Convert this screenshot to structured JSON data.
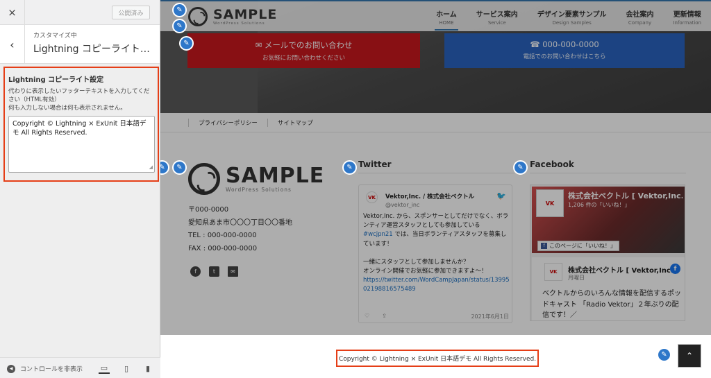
{
  "sidebar": {
    "close_icon": "×",
    "publish_label": "公開済み",
    "back_icon": "‹",
    "breadcrumb": "カスタマイズ中",
    "title": "Lightning コピーライト…",
    "section": {
      "title": "Lightning コピーライト設定",
      "description_1": "代わりに表示したいフッターテキストを入力してください（HTML有効）",
      "description_2": "何も入力しない場合は何も表示されません。",
      "textarea_value": "Copyright © Lightning × ExUnit 日本語デモ All Rights Reserved."
    },
    "hide_controls_label": "コントロールを非表示",
    "devices": [
      "desktop-icon",
      "tablet-icon",
      "mobile-icon"
    ]
  },
  "preview": {
    "logo": {
      "name": "SAMPLE",
      "tagline": "WordPress Solutions"
    },
    "nav": [
      {
        "jp": "ホーム",
        "en": "HOME"
      },
      {
        "jp": "サービス案内",
        "en": "Service"
      },
      {
        "jp": "デザイン要素サンプル",
        "en": "Design Samples"
      },
      {
        "jp": "会社案内",
        "en": "Company"
      },
      {
        "jp": "更新情報",
        "en": "Information"
      }
    ],
    "mail_button": {
      "line1": "✉  メールでのお問い合わせ",
      "line2": "お気軽にお問い合わせください"
    },
    "tel_button": {
      "line1": "☎  000-000-0000",
      "line2": "電話でのお問い合わせはこちら"
    },
    "subnav": [
      "プライバシーポリシー",
      "サイトマップ"
    ],
    "address": {
      "zip": "〒000-0000",
      "street": "愛知県あま市〇〇〇丁目〇〇番地",
      "tel": "TEL : 000-000-0000",
      "fax": "FAX : 000-000-0000"
    },
    "twitter": {
      "title": "Twitter",
      "avatar": "VK",
      "name": "Vektor,Inc. / 株式会社ベクトル",
      "handle": "@vektor_inc",
      "text_1": "Vektor,Inc. から、スポンサーとしてだけでなく、ボランティア運営スタッフとしても参加している",
      "hashtag": "#wcjpn21",
      "text_2": " では、当日ボランティアスタッフを募集しています！",
      "text_3": "一緒にスタッフとして参加しませんか？",
      "text_4": "オンライン開催でお気軽に参加できますよ～！",
      "url": "https://twitter.com/WordCampJapan/status/1399502198816575489",
      "date": "2021年6月1日"
    },
    "facebook": {
      "title": "Facebook",
      "page_name": "株式会社ベクトル [ Vektor,Inc. ]",
      "likes": "1,206 件の「いいね！」",
      "like_button": "このページに「いいね！」",
      "post_name": "株式会社ベクトル [ Vektor,Inc. ]",
      "post_day": "月曜日",
      "post_text": "ベクトルからのいろんな情報を配信するポッドキャスト 「Radio Vektor」２年ぶりの配信です！／"
    },
    "copyright": "Copyright © Lightning × ExUnit 日本語デモ All Rights Reserved.",
    "pagetop_icon": "⌃",
    "accent_blue": "#2e77c9",
    "mail_red": "#c9181e",
    "tel_blue": "#2a64c0",
    "highlight": "#e53e17"
  }
}
